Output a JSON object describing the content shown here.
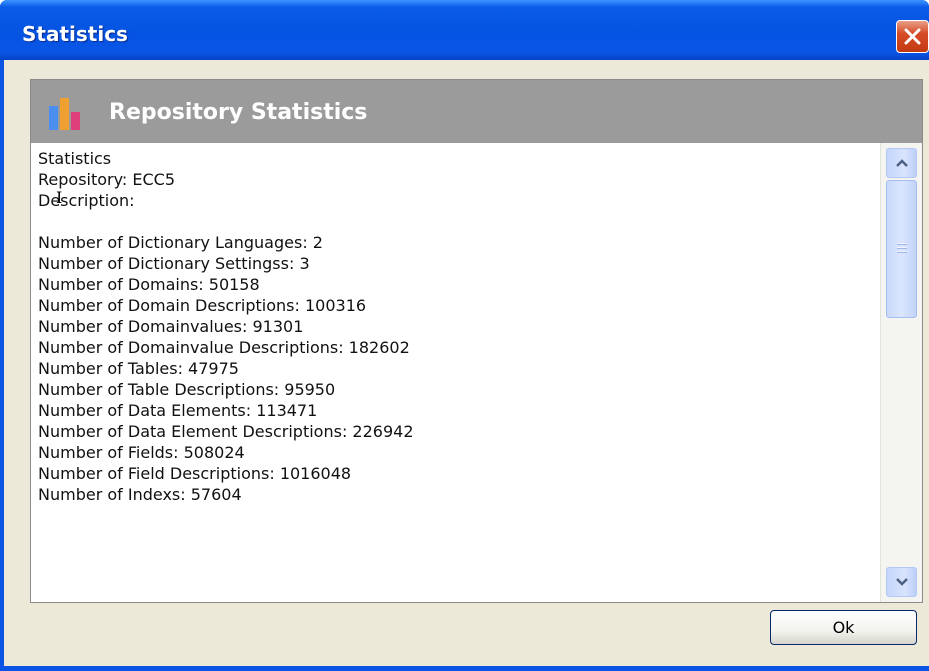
{
  "window": {
    "title": "Statistics",
    "close_icon": "close-x-icon"
  },
  "header": {
    "icon": "bar-chart-icon",
    "title": "Repository Statistics",
    "icon_colors": [
      "#4a8ef0",
      "#f0a030",
      "#e0407a"
    ]
  },
  "stats": {
    "lines": [
      "Statistics",
      "Repository: ECC5",
      "Description:",
      "",
      "Number of Dictionary Languages: 2",
      "Number of Dictionary Settingss: 3",
      "Number of Domains: 50158",
      "Number of Domain Descriptions: 100316",
      "Number of Domainvalues: 91301",
      "Number of Domainvalue Descriptions: 182602",
      "Number of Tables: 47975",
      "Number of Table Descriptions: 95950",
      "Number of Data Elements: 113471",
      "Number of Data Element Descriptions: 226942",
      "Number of Fields: 508024",
      "Number of Field Descriptions: 1016048",
      "Number of Indexs: 57604"
    ]
  },
  "scrollbar": {
    "up_icon": "chevron-up-icon",
    "down_icon": "chevron-down-icon",
    "grip_icon": "scroll-grip-icon"
  },
  "buttons": {
    "ok_label": "Ok"
  }
}
